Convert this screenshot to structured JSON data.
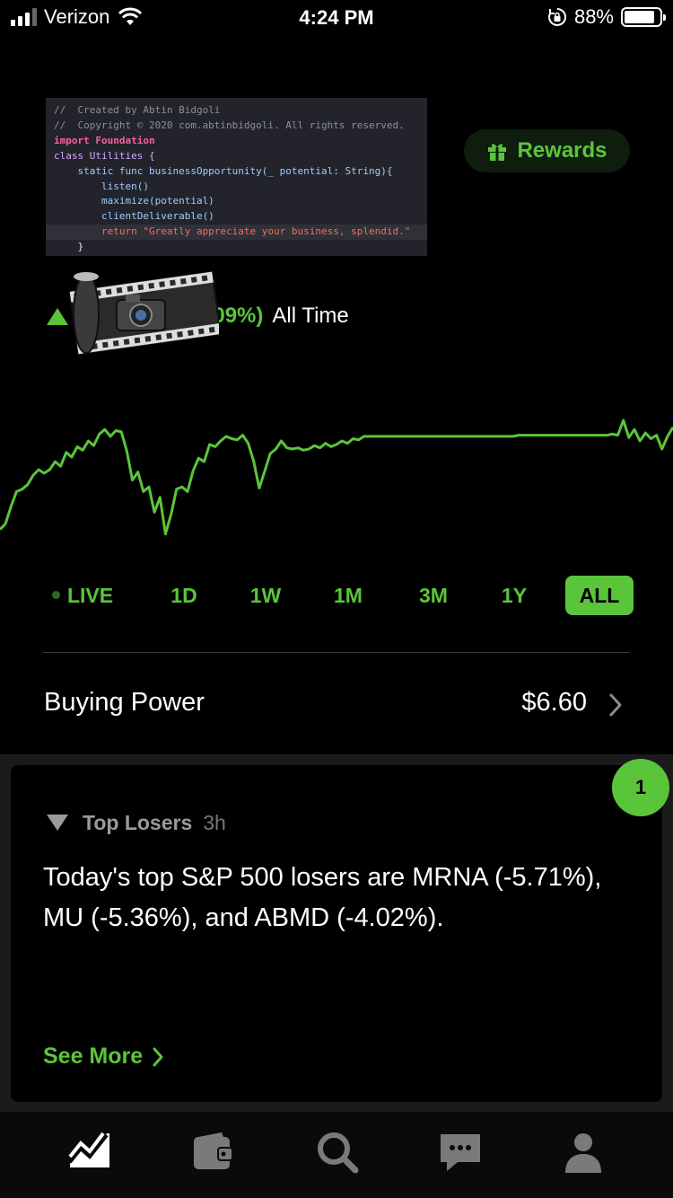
{
  "status_bar": {
    "carrier": "Verizon",
    "time": "4:24 PM",
    "battery": "88%",
    "battery_level": 0.88
  },
  "code_snippet": {
    "lines": [
      "//  Created by Abtin Bidgoli",
      "//  Copyright © 2020 com.abtinbidgoli. All rights reserved.",
      "import Foundation",
      "class Utilities {",
      "    static func businessOpportunity(_ potential: String){",
      "        listen()",
      "        maximize(potential)",
      "        clientDeliverable()",
      "        return \"Greatly appreciate your business, splendid.\"",
      "    }"
    ]
  },
  "rewards": {
    "label": "Rewards",
    "icon": "gift-icon"
  },
  "performance": {
    "change": "57.09%)",
    "period": "All Time",
    "direction": "up"
  },
  "chart_data": {
    "type": "line",
    "color": "#5ac53b",
    "y_relative": [
      0.95,
      0.9,
      0.75,
      0.62,
      0.6,
      0.56,
      0.48,
      0.43,
      0.46,
      0.43,
      0.36,
      0.4,
      0.28,
      0.32,
      0.23,
      0.26,
      0.18,
      0.22,
      0.12,
      0.08,
      0.14,
      0.09,
      0.1,
      0.27,
      0.52,
      0.45,
      0.62,
      0.58,
      0.8,
      0.67,
      0.99,
      0.82,
      0.6,
      0.58,
      0.62,
      0.44,
      0.33,
      0.36,
      0.21,
      0.23,
      0.18,
      0.14,
      0.16,
      0.17,
      0.13,
      0.2,
      0.36,
      0.59,
      0.44,
      0.29,
      0.25,
      0.18,
      0.24,
      0.25,
      0.24,
      0.26,
      0.25,
      0.22,
      0.24,
      0.2,
      0.23,
      0.21,
      0.18,
      0.2,
      0.16,
      0.17,
      0.14,
      0.14,
      0.14,
      0.14,
      0.14,
      0.14,
      0.14,
      0.14,
      0.14,
      0.14,
      0.14,
      0.14,
      0.14,
      0.14,
      0.14,
      0.14,
      0.14,
      0.14,
      0.14,
      0.14,
      0.14,
      0.14,
      0.14,
      0.14,
      0.14,
      0.14,
      0.14,
      0.14,
      0.13,
      0.13,
      0.13,
      0.13,
      0.13,
      0.13,
      0.13,
      0.13,
      0.13,
      0.13,
      0.13,
      0.13,
      0.13,
      0.13,
      0.13,
      0.13,
      0.13,
      0.12,
      0.13,
      0.0,
      0.15,
      0.08,
      0.18,
      0.11,
      0.16,
      0.13,
      0.25,
      0.14,
      0.06
    ]
  },
  "ranges": [
    {
      "label": "LIVE",
      "live": true
    },
    {
      "label": "1D"
    },
    {
      "label": "1W"
    },
    {
      "label": "1M"
    },
    {
      "label": "3M"
    },
    {
      "label": "1Y"
    },
    {
      "label": "ALL",
      "active": true
    }
  ],
  "buying_power": {
    "label": "Buying Power",
    "value": "$6.60"
  },
  "card": {
    "badge": "1",
    "title": "Top Losers",
    "time": "3h",
    "body": "Today's top S&P 500 losers are MRNA (-5.71%), MU (-5.36%), and ABMD (-4.02%).",
    "link": "See More"
  },
  "tabs": [
    {
      "icon": "portfolio-chart-icon",
      "active": true
    },
    {
      "icon": "wallet-icon"
    },
    {
      "icon": "search-icon"
    },
    {
      "icon": "messages-icon"
    },
    {
      "icon": "account-icon"
    }
  ],
  "colors": {
    "accent": "#5ac53b",
    "background": "#000000"
  }
}
